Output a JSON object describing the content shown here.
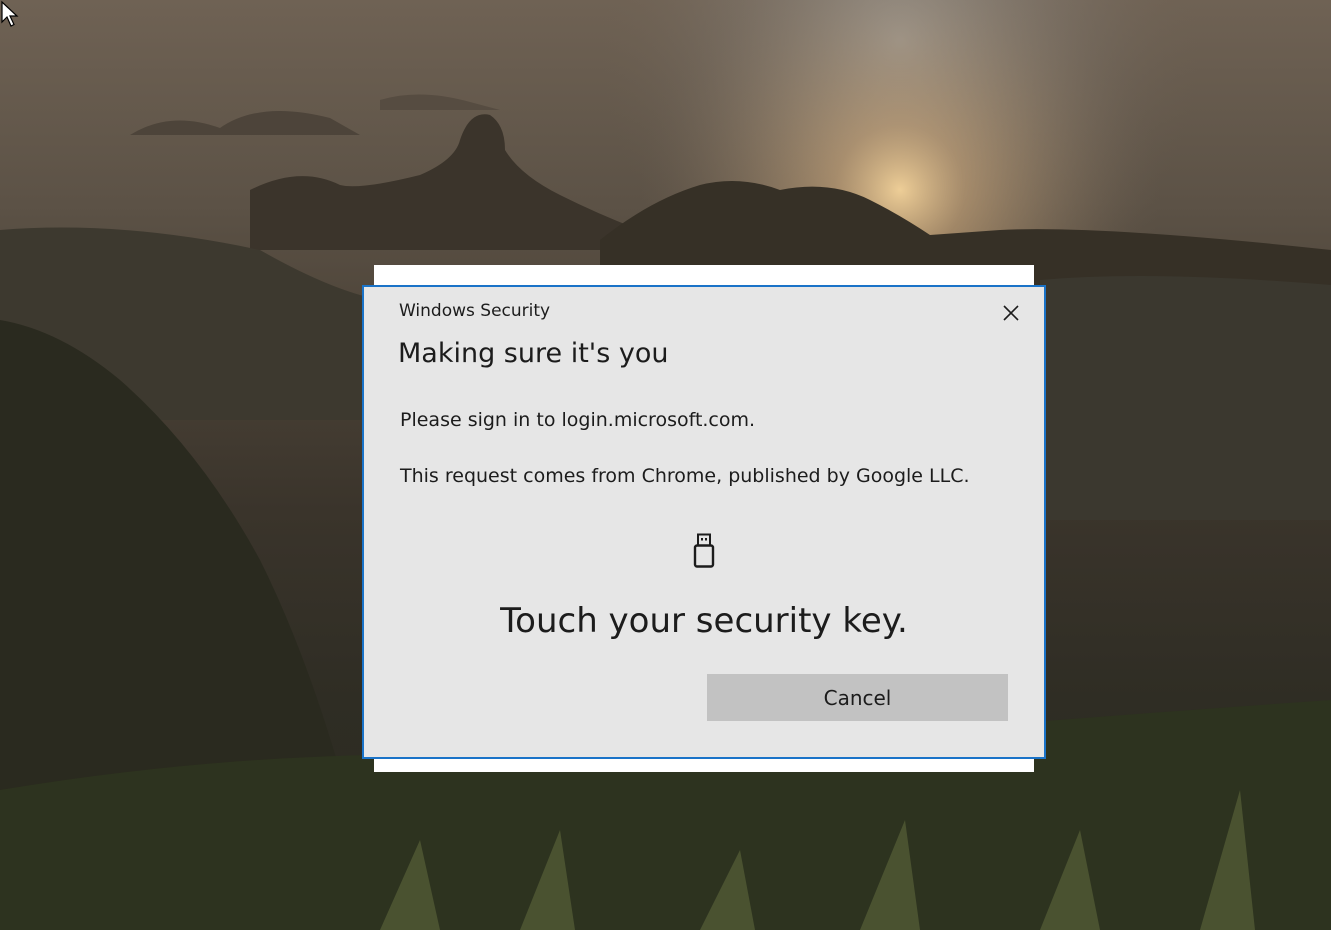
{
  "dialog": {
    "window_title": "Windows Security",
    "heading": "Making sure it's you",
    "message_signin": "Please sign in to login.microsoft.com.",
    "message_origin": "This request comes from Chrome, published by Google LLC.",
    "prompt": "Touch your security key.",
    "cancel_label": "Cancel",
    "accent_color": "#1a73c8"
  },
  "icons": {
    "close": "close-icon",
    "security_key": "usb-security-key-icon",
    "cursor": "mouse-cursor-icon"
  }
}
